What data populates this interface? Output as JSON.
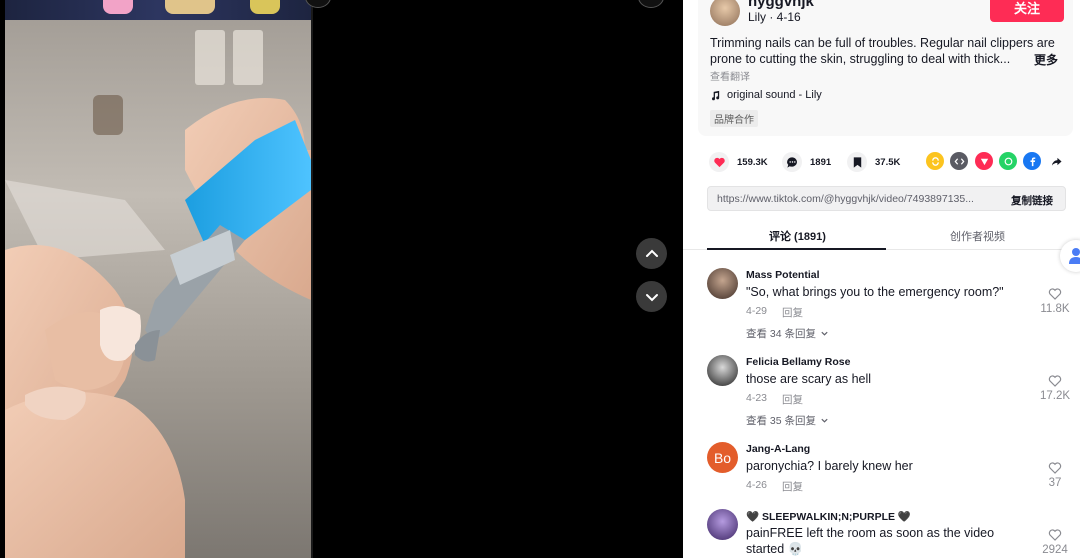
{
  "author": {
    "username": "hyggvhjk",
    "subline": "Lily · 4-16",
    "follow_label": "关注"
  },
  "description": {
    "line1": "Trimming nails can be full of troubles. Regular nail clippers are",
    "line2": "prone to cutting the skin, struggling to deal with thick...",
    "more_label": "更多",
    "translate_label": "查看翻译",
    "sound": "original sound - Lily",
    "brand_tag": "品牌合作"
  },
  "stats": {
    "likes": "159.3K",
    "comments": "1891",
    "saves": "37.5K"
  },
  "link": {
    "url": "https://www.tiktok.com/@hyggvhjk/video/7493897135...",
    "copy_label": "复制链接"
  },
  "tabs": {
    "comments_tab": "评论 (1891)",
    "creator_videos_tab": "创作者视频"
  },
  "comments": [
    {
      "name": "Mass Potential",
      "text": "\"So, what brings you to the emergency room?\"",
      "date": "4-29",
      "reply_label": "回复",
      "view_replies": "查看 34 条回复",
      "likes": "11.8K"
    },
    {
      "name": "Felicia Bellamy Rose",
      "text": "those are scary as hell",
      "date": "4-23",
      "reply_label": "回复",
      "view_replies": "查看 35 条回复",
      "likes": "17.2K"
    },
    {
      "name": "Jang-A-Lang",
      "avatar_initials": "Bo",
      "text": "paronychia? I barely knew her",
      "date": "4-26",
      "reply_label": "回复",
      "likes": "37"
    },
    {
      "name": "🖤 SLEEPWALKIN;N;PURPLE 🖤",
      "text": "painFREE left the room as soon as the video started 💀",
      "likes": "2924"
    }
  ],
  "colors": {
    "accent": "#fe2c55",
    "text": "#161823",
    "muted": "#8a8b91"
  }
}
